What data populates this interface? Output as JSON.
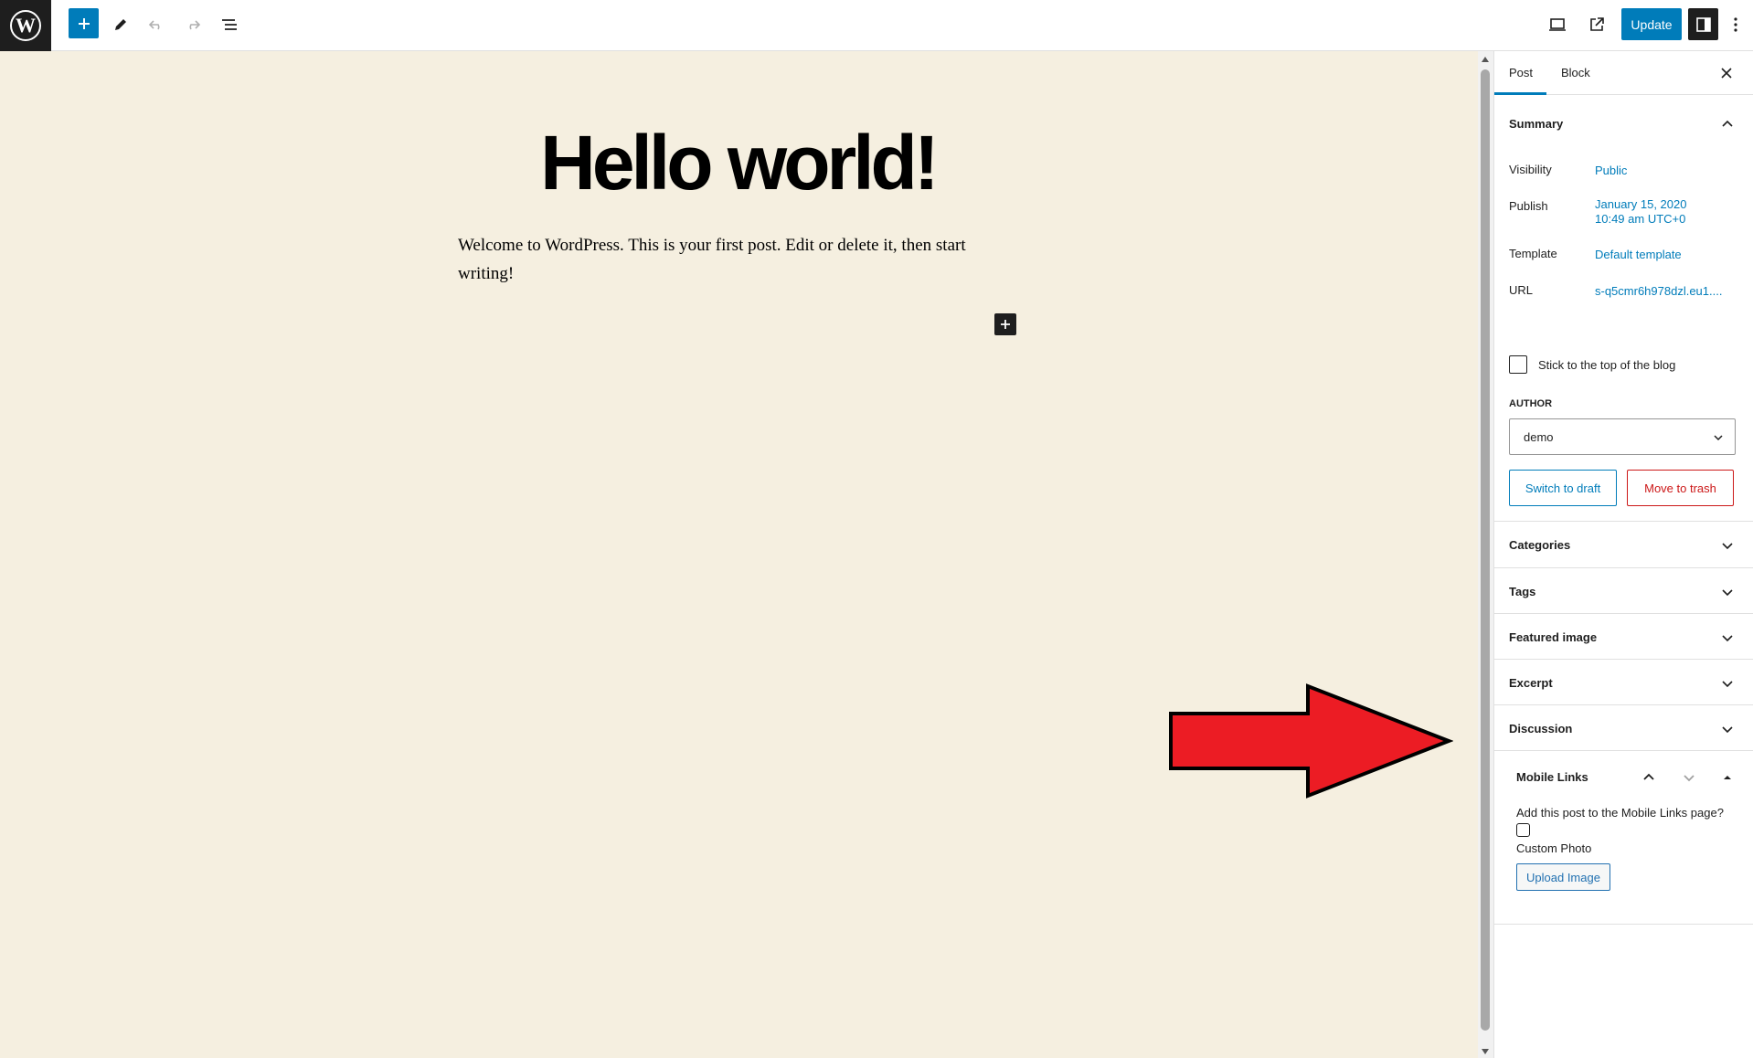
{
  "toolbar": {
    "update_label": "Update"
  },
  "editor": {
    "title": "Hello world!",
    "body": "Welcome to WordPress. This is your first post. Edit or delete it, then start writing!"
  },
  "sidebar": {
    "tabs": [
      "Post",
      "Block"
    ],
    "summary": {
      "title": "Summary",
      "visibility_label": "Visibility",
      "visibility_value": "Public",
      "publish_label": "Publish",
      "publish_date": "January 15, 2020",
      "publish_time": "10:49 am UTC+0",
      "template_label": "Template",
      "template_value": "Default template",
      "url_label": "URL",
      "url_value": "s-q5cmr6h978dzl.eu1....",
      "sticky_label": "Stick to the top of the blog",
      "author_label": "AUTHOR",
      "author_value": "demo",
      "switch_draft_label": "Switch to draft",
      "trash_label": "Move to trash"
    },
    "panels": [
      "Categories",
      "Tags",
      "Featured image",
      "Excerpt",
      "Discussion"
    ],
    "mobile_links": {
      "title": "Mobile Links",
      "add_label": "Add this post to the Mobile Links page?",
      "custom_photo_label": "Custom Photo",
      "upload_label": "Upload Image"
    }
  },
  "colors": {
    "accent": "#007cba",
    "danger": "#cc1818",
    "canvas": "#f5efe0",
    "annotation": "#ec1c24"
  }
}
